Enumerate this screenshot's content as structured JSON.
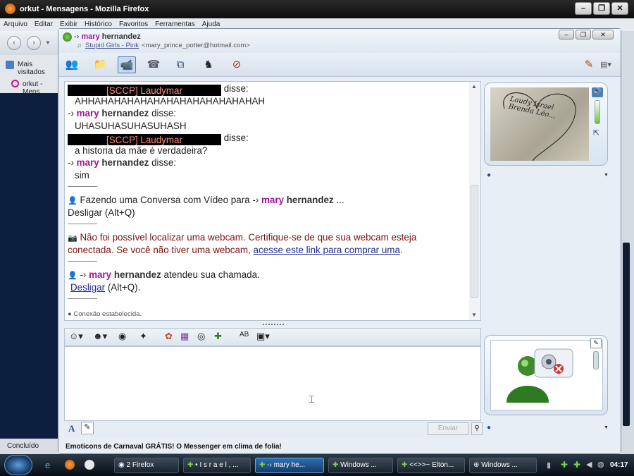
{
  "firefox": {
    "title": "orkut - Mensagens - Mozilla Firefox",
    "menu": [
      "Arquivo",
      "Editar",
      "Exibir",
      "Histórico",
      "Favoritos",
      "Ferramentas",
      "Ajuda"
    ],
    "bookmark": "Mais visitados",
    "tab": "orkut - Mens",
    "status": "Concluído"
  },
  "msn": {
    "contact_arrow": "-› ",
    "contact_first": "mary",
    "contact_last": " hernandez",
    "contact_status": "Stupid Girls - Pink",
    "contact_email": "<mary_prince_potter@hotmail.com>",
    "messages": {
      "m1_name": "[SCCP] Laudymar",
      "m1_said": " disse:",
      "m1_text": "AHHAHAHAHAHAHAHAHAHAHAHAHAHAH",
      "m2_arrow": "-› ",
      "m2_first": "mary",
      "m2_last": " hernandez",
      "m2_said": " disse:",
      "m2_text": "UHASUHASUHASUHASH",
      "m3_name": "[SCCP] Laudymar",
      "m3_said": " disse:",
      "m3_text": "a historia da mãe é verdadeira?",
      "m4_arrow": "-› ",
      "m4_first": "mary",
      "m4_last": " hernandez",
      "m4_said": " disse:",
      "m4_text": "sim",
      "video_pre": "Fazendo uma Conversa com Vídeo para ",
      "video_arrow": "-› ",
      "video_first": "mary",
      "video_last": " hernandez",
      "video_post": " ...",
      "video_hangup": "Desligar (Alt+Q)",
      "webcam_err_1": "Não foi possível localizar uma webcam. Certifique-se de que sua webcam esteja",
      "webcam_err_2": "conectada. Se você não tiver uma webcam, ",
      "webcam_link": "acesse este link para comprar uma",
      "webcam_err_end": ".",
      "answer_arrow": "-› ",
      "answer_first": "mary",
      "answer_last": " hernandez",
      "answer_text": " atendeu sua chamada.",
      "answer_hangup_link": "Desligar",
      "answer_hangup_key": " (Alt+Q).",
      "status_line": "Conexão estabelecida."
    },
    "send": "Enviar",
    "ad": "Emoticons de Carnaval GRÁTIS! O Messenger em clima de folia!",
    "webcam_doodle": "Laudy Israel Brenda Léo..."
  },
  "taskbar": {
    "items": [
      "2 Firefox",
      "• I s r a e l , ...",
      "-› mary he...",
      "Windows ...",
      "<<>>~ Elton...",
      "Windows ..."
    ],
    "clock": "04:17"
  }
}
